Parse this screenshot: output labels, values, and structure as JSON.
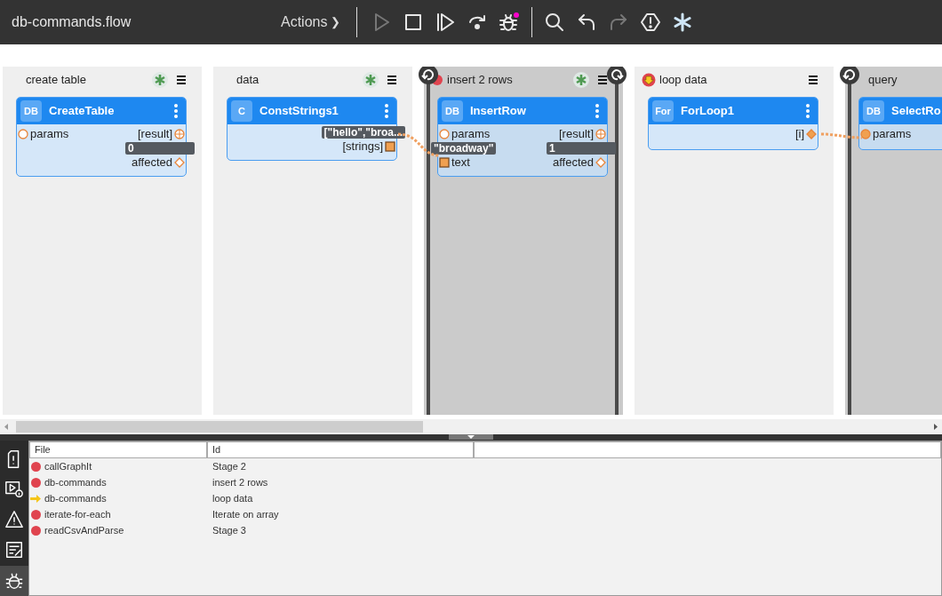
{
  "title": "db-commands.flow",
  "actions": {
    "label": "Actions",
    "chevron": "❯"
  },
  "toolbar": [
    {
      "kind": "play",
      "disabled": true
    },
    {
      "kind": "stop",
      "disabled": false
    },
    {
      "kind": "step",
      "disabled": false
    },
    {
      "kind": "step-over",
      "disabled": false
    },
    {
      "kind": "debug",
      "disabled": false,
      "badge": true
    },
    {
      "kind": "separator"
    },
    {
      "kind": "search",
      "disabled": false
    },
    {
      "kind": "undo",
      "disabled": false
    },
    {
      "kind": "redo",
      "disabled": true
    },
    {
      "kind": "alert",
      "disabled": false
    },
    {
      "kind": "asterisk",
      "disabled": false
    }
  ],
  "stages": [
    {
      "title": "create table",
      "kind": "normal",
      "breakpoint": false,
      "current": false,
      "star": true,
      "menu": true,
      "node": {
        "badge": "DB",
        "name": "CreateTable",
        "rows": [
          {
            "left": {
              "label": "params",
              "kind": "circle",
              "filled": false
            },
            "right": {
              "label": "[result]",
              "kind": "circle-cross",
              "filled": false
            }
          },
          {
            "right": {
              "label": "affected",
              "kind": "diamond",
              "filled": false,
              "value": "0"
            }
          }
        ]
      }
    },
    {
      "title": "data",
      "kind": "normal",
      "breakpoint": false,
      "current": false,
      "star": true,
      "menu": true,
      "node": {
        "badge": "C",
        "name": "ConstStrings1",
        "rows": [
          {
            "right": {
              "label": "[strings]",
              "kind": "square",
              "filled": true,
              "value": "[\"hello\",\"broa..."
            }
          }
        ]
      }
    },
    {
      "title": "insert 2 rows",
      "kind": "running",
      "breakpoint": true,
      "current": false,
      "star": true,
      "menu": true,
      "loop_end": true,
      "node": {
        "badge": "DB",
        "name": "InsertRow",
        "rows": [
          {
            "left": {
              "label": "params",
              "kind": "circle",
              "filled": false
            },
            "right": {
              "label": "[result]",
              "kind": "circle-cross",
              "filled": false
            }
          },
          {
            "left": {
              "label": "text",
              "kind": "square",
              "filled": true,
              "value": "\"broadway\""
            },
            "right": {
              "label": "affected",
              "kind": "diamond",
              "filled": false,
              "value": "1"
            }
          }
        ]
      }
    },
    {
      "title": "loop data",
      "kind": "normal",
      "breakpoint": false,
      "current": true,
      "star": false,
      "menu": true,
      "node": {
        "badge": "For",
        "name": "ForLoop1",
        "rows": [
          {
            "right": {
              "label": "[i]",
              "kind": "diamond",
              "filled": true
            }
          }
        ]
      }
    },
    {
      "title": "query",
      "kind": "running",
      "breakpoint": false,
      "current": false,
      "star": false,
      "menu": false,
      "loop_end": false,
      "node": {
        "badge": "DB",
        "name": "SelectRo",
        "more": false,
        "rows": [
          {
            "left": {
              "label": "params",
              "kind": "circle",
              "filled": true
            }
          }
        ]
      }
    }
  ],
  "side_tabs": [
    {
      "kind": "file-alert",
      "selected": false
    },
    {
      "kind": "play-info",
      "selected": false
    },
    {
      "kind": "warning",
      "selected": false
    },
    {
      "kind": "edit",
      "selected": false
    },
    {
      "kind": "debug",
      "selected": true
    }
  ],
  "table": {
    "columns": [
      "File",
      "Id"
    ],
    "rows": [
      {
        "kind": "breakpoint",
        "file": "callGraphIt",
        "id": "Stage 2"
      },
      {
        "kind": "breakpoint",
        "file": "db-commands",
        "id": "insert 2 rows"
      },
      {
        "kind": "current",
        "file": "db-commands",
        "id": "loop data"
      },
      {
        "kind": "breakpoint",
        "file": "iterate-for-each",
        "id": "Iterate on array"
      },
      {
        "kind": "breakpoint",
        "file": "readCsvAndParse",
        "id": "Stage 3"
      }
    ]
  }
}
